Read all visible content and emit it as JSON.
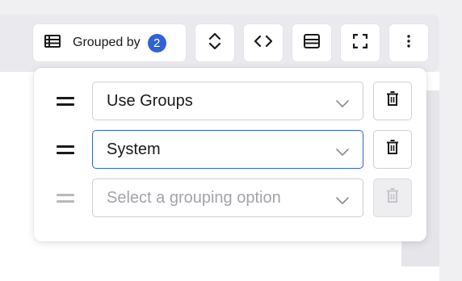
{
  "toolbar": {
    "grouped_label": "Grouped by",
    "grouped_count": "2",
    "buttons": [
      "table-icon",
      "sort-icon",
      "code-icon",
      "rows-icon",
      "fullscreen-icon",
      "more-icon"
    ]
  },
  "grouping": {
    "rows": [
      {
        "value": "Use Groups",
        "state": "normal"
      },
      {
        "value": "System",
        "state": "focused"
      }
    ],
    "placeholder": "Select a grouping option"
  },
  "colors": {
    "accent": "#2f62d6",
    "text": "#1a1a1a",
    "placeholder": "#a3a3aa",
    "border": "#cfcfd6"
  }
}
